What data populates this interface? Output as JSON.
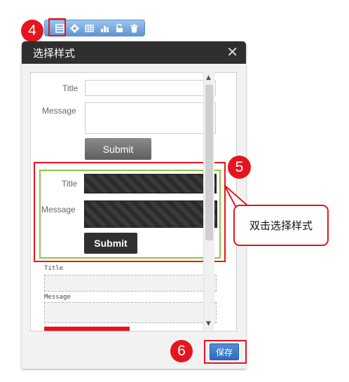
{
  "steps": {
    "toolbar": "4",
    "style_select": "5",
    "save": "6"
  },
  "dialog": {
    "title": "选择样式",
    "close_glyph": "✕"
  },
  "style1": {
    "title_label": "Title",
    "message_label": "Message",
    "submit_label": "Submit"
  },
  "style2": {
    "title_label": "Title",
    "message_label": "Message",
    "submit_label": "Submit"
  },
  "style3": {
    "title_label": "Title",
    "message_label": "Message"
  },
  "callout": {
    "text": "双击选择样式"
  },
  "footer": {
    "save_label": "保存"
  },
  "toolbar": {
    "icons": [
      "layout-icon",
      "gear-icon",
      "grid-icon",
      "chart-icon",
      "unlock-icon",
      "trash-icon"
    ]
  },
  "colors": {
    "step_red": "#e3161e",
    "selected_green": "#8cc63f",
    "toolbar_blue": "#5f95d3",
    "button_blue": "#2d6bbf"
  }
}
